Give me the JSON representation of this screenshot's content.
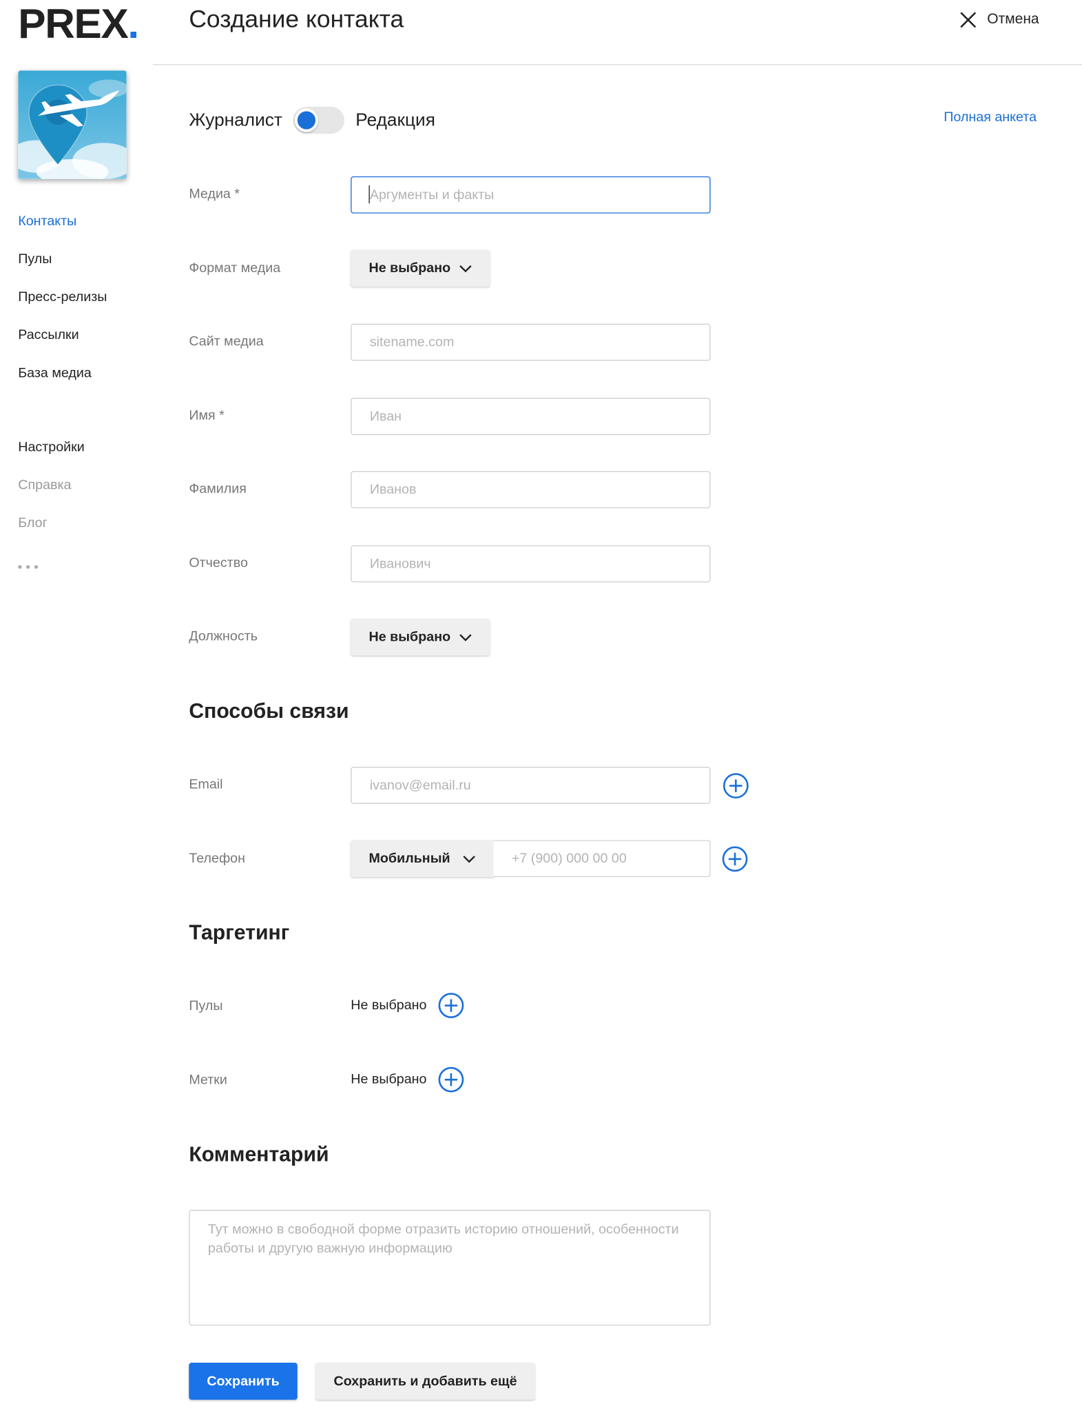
{
  "logo": {
    "text": "PREX",
    "dot": "."
  },
  "sidebar": {
    "items": [
      {
        "label": "Контакты"
      },
      {
        "label": "Пулы"
      },
      {
        "label": "Пресс-релизы"
      },
      {
        "label": "Рассылки"
      },
      {
        "label": "База медиа"
      },
      {
        "label": "Настройки"
      },
      {
        "label": "Справка"
      },
      {
        "label": "Блог"
      }
    ],
    "more_icon": "ellipsis-icon"
  },
  "header": {
    "title": "Создание контакта",
    "cancel_label": "Отмена",
    "cancel_icon": "close-icon"
  },
  "toggle": {
    "left_label": "Журналист",
    "right_label": "Редакция",
    "full_form_link": "Полная анкета"
  },
  "form": {
    "media": {
      "label": "Медиа *",
      "placeholder": "Аргументы и факты"
    },
    "media_format": {
      "label": "Формат медиа",
      "value": "Не выбрано"
    },
    "media_site": {
      "label": "Сайт медиа",
      "placeholder": "sitename.com"
    },
    "first_name": {
      "label": "Имя *",
      "placeholder": "Иван"
    },
    "last_name": {
      "label": "Фамилия",
      "placeholder": "Иванов"
    },
    "middle_name": {
      "label": "Отчество",
      "placeholder": "Иванович"
    },
    "position": {
      "label": "Должность",
      "value": "Не выбрано"
    }
  },
  "contacts": {
    "title": "Способы связи",
    "email": {
      "label": "Email",
      "placeholder": "ivanov@email.ru"
    },
    "phone": {
      "label": "Телефон",
      "type": "Мобильный",
      "placeholder": "+7 (900) 000 00 00"
    }
  },
  "targeting": {
    "title": "Таргетинг",
    "pools": {
      "label": "Пулы",
      "value": "Не выбрано"
    },
    "tags": {
      "label": "Метки",
      "value": "Не выбрано"
    }
  },
  "comment": {
    "title": "Комментарий",
    "placeholder": "Тут можно в свободной форме отразить историю отношений, особенности работы и другую важную информацию"
  },
  "actions": {
    "save": "Сохранить",
    "save_and_add": "Сохранить и добавить ещё"
  },
  "colors": {
    "accent": "#1a73e8",
    "link": "#1a6fd8",
    "muted_text": "#777777"
  }
}
